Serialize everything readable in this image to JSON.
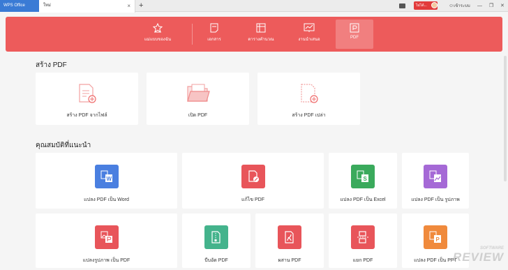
{
  "titlebar": {
    "app_tab": "WPS Office",
    "doc_tab": "ใหม่",
    "close_glyph": "×",
    "new_tab_glyph": "+",
    "badge": "ไม่ได้...",
    "login": "เข้าระบบ",
    "minimize": "—",
    "restore": "❐",
    "close": "✕"
  },
  "ribbon": {
    "items": [
      {
        "label": "แม่แบบของฉัน",
        "icon": "star-icon"
      },
      {
        "label": "เอกสาร",
        "icon": "document-icon"
      },
      {
        "label": "ตารางคำนวณ",
        "icon": "spreadsheet-icon"
      },
      {
        "label": "งานนำเสนอ",
        "icon": "presentation-icon"
      },
      {
        "label": "PDF",
        "icon": "pdf-icon"
      }
    ],
    "active": "PDF",
    "color": "#ed5b5b"
  },
  "create_pdf": {
    "title": "สร้าง PDF",
    "cards": [
      {
        "label": "สร้าง PDF จากไฟล์",
        "icon": "file-add-icon"
      },
      {
        "label": "เปิด PDF",
        "icon": "folder-open-icon"
      },
      {
        "label": "สร้าง PDF เปล่า",
        "icon": "blank-pdf-icon"
      }
    ]
  },
  "features": {
    "title": "คุณสมบัติที่แนะนำ",
    "row1": [
      {
        "label": "แปลง PDF เป็น Word",
        "icon": "pdf-to-word-icon",
        "color": "#4a7fe0"
      },
      {
        "label": "แก้ไข PDF",
        "icon": "edit-pdf-icon",
        "color": "#e8555a"
      },
      {
        "label": "แปลง PDF เป็น Excel",
        "icon": "pdf-to-excel-icon",
        "color": "#3aaa5c"
      },
      {
        "label": "แปลง PDF เป็น รูปภาพ",
        "icon": "pdf-to-image-icon",
        "color": "#a569d6"
      }
    ],
    "row2": [
      {
        "label": "แปลงรูปภาพ เป็น PDF",
        "icon": "image-to-pdf-icon",
        "color": "#e8555a"
      },
      {
        "label": "บีบอัด PDF",
        "icon": "compress-pdf-icon",
        "color": "#44b38c"
      },
      {
        "label": "ผสาน PDF",
        "icon": "merge-pdf-icon",
        "color": "#e8555a"
      },
      {
        "label": "แยก PDF",
        "icon": "split-pdf-icon",
        "color": "#e8555a"
      },
      {
        "label": "แปลง PDF เป็น PPT",
        "icon": "pdf-to-ppt-icon",
        "color": "#f08a3c"
      }
    ]
  },
  "watermark": {
    "line1": "SOFTWARE",
    "line2": "REVIEW"
  }
}
